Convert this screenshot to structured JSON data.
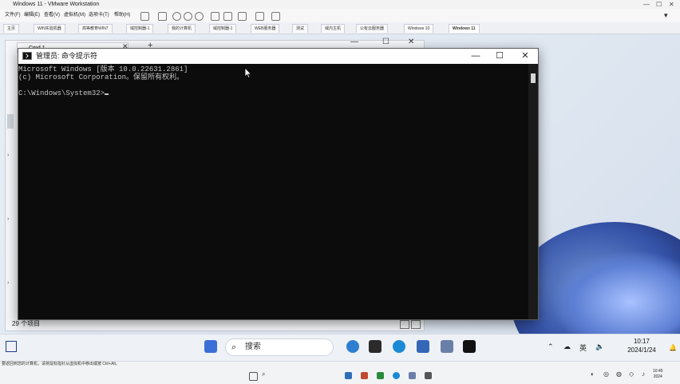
{
  "host": {
    "window_title": "Windows 11 - VMware Workstation",
    "menu": [
      "文件(F)",
      "编辑(E)",
      "查看(V)",
      "虚拟机(M)",
      "选项卡(T)",
      "帮助(H)"
    ],
    "tabs": [
      "主页",
      "WIN实验机器",
      "高等教育WIN7",
      "域控制器-1",
      "我的计算机",
      "域控制器-1",
      "WEB服务器",
      "测试",
      "域内主机",
      "公有云服务器",
      "Windows 10",
      "Windows 11"
    ],
    "active_tab": "Windows 11",
    "hint": "要返回到您的计算机，请将鼠标指针从虚拟机中移出或按 Ctrl+Alt。",
    "clock_time": "10:45",
    "clock_year": "2024"
  },
  "explorer": {
    "tab_title": "Cmd 1",
    "status": "29 个项目"
  },
  "cmd": {
    "title": "管理员: 命令提示符",
    "lines": [
      "Microsoft Windows [版本 10.0.22631.2861]",
      "(c) Microsoft Corporation。保留所有权利。",
      "",
      "C:\\Windows\\System32>"
    ],
    "controls": {
      "minimize": "—",
      "maximize": "☐",
      "close": "✕"
    }
  },
  "taskbar": {
    "search_placeholder": "搜索",
    "tray_lang": "英",
    "time": "10:17",
    "date": "2024/1/24"
  },
  "colors": {
    "console_bg": "#0c0c0c",
    "console_fg": "#c4c4c4",
    "taskbar_bg": "#eef1f6"
  }
}
